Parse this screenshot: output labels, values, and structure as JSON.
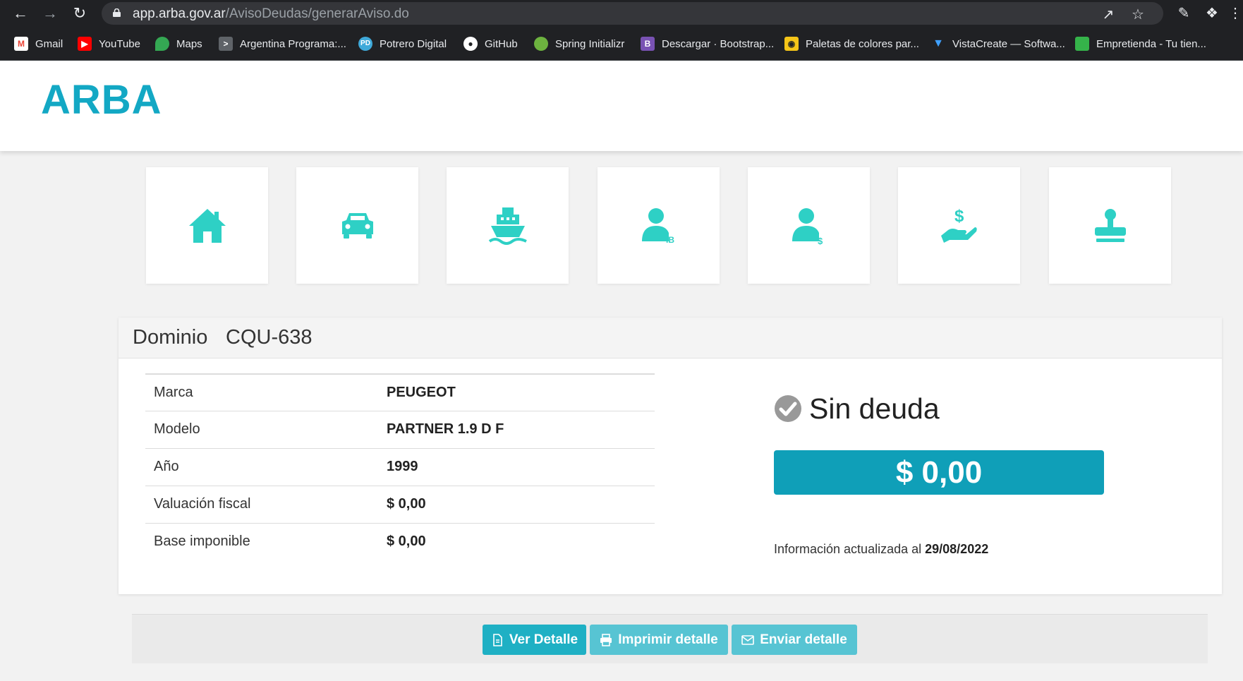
{
  "browser": {
    "url_host": "app.arba.gov.ar",
    "url_path": "/AvisoDeudas/generarAviso.do",
    "bookmarks": [
      {
        "label": "Gmail",
        "icon": "gmail-icon",
        "color": "#ea4335"
      },
      {
        "label": "YouTube",
        "icon": "youtube-icon",
        "color": "#ff0000"
      },
      {
        "label": "Maps",
        "icon": "maps-icon",
        "color": "#34a853"
      },
      {
        "label": "Argentina Programa:...",
        "icon": "terminal-icon",
        "color": "#5f6368"
      },
      {
        "label": "Potrero Digital",
        "icon": "pd-icon",
        "color": "#3fa9d9"
      },
      {
        "label": "GitHub",
        "icon": "github-icon",
        "color": "#ffffff"
      },
      {
        "label": "Spring Initializr",
        "icon": "spring-icon",
        "color": "#6db33f"
      },
      {
        "label": "Descargar · Bootstrap...",
        "icon": "bootstrap-icon",
        "color": "#7952b3"
      },
      {
        "label": "Paletas de colores par...",
        "icon": "palette-icon",
        "color": "#f5c518"
      },
      {
        "label": "VistaCreate — Softwa...",
        "icon": "vistacreate-icon",
        "color": "#3fa0ff"
      },
      {
        "label": "Empretienda - Tu tien...",
        "icon": "empretienda-icon",
        "color": "#35b34a"
      }
    ]
  },
  "brand": {
    "logo": "ARBA",
    "accent": "#13a8c4",
    "icon_color": "#2ed0c5"
  },
  "tiles": [
    {
      "icon": "house-icon"
    },
    {
      "icon": "car-icon"
    },
    {
      "icon": "ship-icon"
    },
    {
      "icon": "user-ib-icon"
    },
    {
      "icon": "user-dollar-icon"
    },
    {
      "icon": "hand-dollar-icon"
    },
    {
      "icon": "stamp-icon"
    }
  ],
  "card": {
    "title": "Dominio",
    "domain": "CQU-638",
    "rows": [
      {
        "label": "Marca",
        "value": "PEUGEOT"
      },
      {
        "label": "Modelo",
        "value": "PARTNER 1.9 D F"
      },
      {
        "label": "Año",
        "value": "1999"
      },
      {
        "label": "Valuación fiscal",
        "value": "$ 0,00"
      },
      {
        "label": "Base imponible",
        "value": "$ 0,00"
      }
    ],
    "status": "Sin deuda",
    "amount": "$ 0,00",
    "updated_label": "Información actualizada al",
    "updated_date": "29/08/2022"
  },
  "actions": {
    "ver": "Ver Detalle",
    "imprimir": "Imprimir detalle",
    "enviar": "Enviar detalle"
  }
}
